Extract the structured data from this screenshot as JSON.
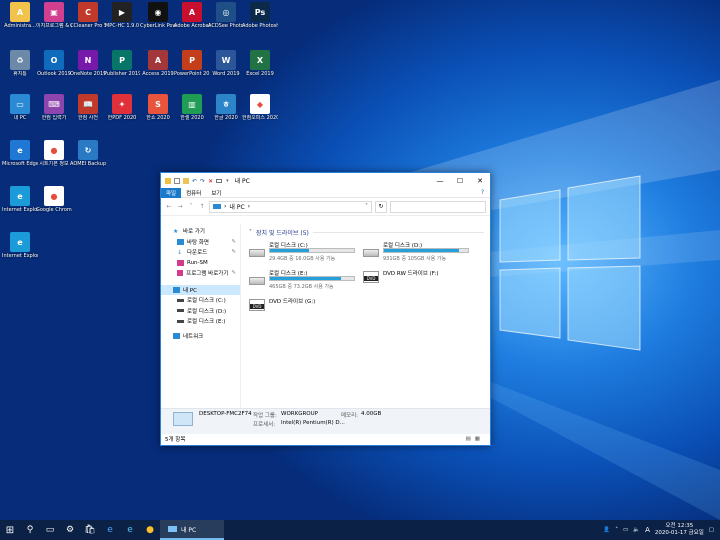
{
  "desktop": {
    "icons": [
      {
        "label": "Administra...",
        "icon": "user-folder-icon",
        "color": "#f3c24a",
        "glyph": "A"
      },
      {
        "label": "이지프로그램 & 종료기",
        "icon": "tv-icon",
        "color": "#d23f8e",
        "glyph": "▣"
      },
      {
        "label": "CCleaner Pro 5.63",
        "icon": "ccleaner-icon",
        "color": "#c0392b",
        "glyph": "C"
      },
      {
        "label": "MPC-HC 1.9.0",
        "icon": "mpc-icon",
        "color": "#222",
        "glyph": "▶"
      },
      {
        "label": "CyberLink PowerDV...",
        "icon": "powerdvd-icon",
        "color": "#111",
        "glyph": "◉"
      },
      {
        "label": "Adobe Acrobat DC",
        "icon": "acrobat-icon",
        "color": "#c8102e",
        "glyph": "A"
      },
      {
        "label": "ACDSee Photo Stud...",
        "icon": "acdsee-icon",
        "color": "#1e4f86",
        "glyph": "◎"
      },
      {
        "label": "Adobe Photosh...",
        "icon": "photoshop-icon",
        "color": "#0b2a4a",
        "glyph": "Ps"
      },
      {
        "label": "휴지통",
        "icon": "recycle-bin-icon",
        "color": "#6c8aa8",
        "glyph": "♻"
      },
      {
        "label": "Outlook 2019",
        "icon": "outlook-icon",
        "color": "#0f6cbd",
        "glyph": "O"
      },
      {
        "label": "OneNote 2019",
        "icon": "onenote-icon",
        "color": "#7719aa",
        "glyph": "N"
      },
      {
        "label": "Publisher 2019",
        "icon": "publisher-icon",
        "color": "#077568",
        "glyph": "P"
      },
      {
        "label": "Access 2019",
        "icon": "access-icon",
        "color": "#a4373a",
        "glyph": "A"
      },
      {
        "label": "PowerPoint 2019",
        "icon": "powerpoint-icon",
        "color": "#c43e1c",
        "glyph": "P"
      },
      {
        "label": "Word 2019",
        "icon": "word-icon",
        "color": "#2b579a",
        "glyph": "W"
      },
      {
        "label": "Excel 2019",
        "icon": "excel-icon",
        "color": "#217346",
        "glyph": "X"
      },
      {
        "label": "내 PC",
        "icon": "this-pc-icon",
        "color": "#2a8ad4",
        "glyph": "▭"
      },
      {
        "label": "한컴 입력기",
        "icon": "hancom-input-icon",
        "color": "#8e44ad",
        "glyph": "⌨"
      },
      {
        "label": "한컴 사전",
        "icon": "hancom-dictionary-icon",
        "color": "#c0392b",
        "glyph": "📖"
      },
      {
        "label": "한PDF 2020",
        "icon": "hanpdf-icon",
        "color": "#e0303a",
        "glyph": "✦"
      },
      {
        "label": "한쇼 2020",
        "icon": "hanshow-icon",
        "color": "#e8543c",
        "glyph": "S"
      },
      {
        "label": "한셀 2020",
        "icon": "hancell-icon",
        "color": "#1f9d55",
        "glyph": "▥"
      },
      {
        "label": "한글 2020",
        "icon": "hangul-icon",
        "color": "#2c85c8",
        "glyph": "ㅎ"
      },
      {
        "label": "한컴오피스 2020",
        "icon": "hancom-office-icon",
        "color": "#ffffff",
        "glyph": "◆"
      },
      {
        "label": "Microsoft Edge",
        "icon": "edge-icon",
        "color": "#1e78d4",
        "glyph": "e"
      },
      {
        "label": "시트기본 정보",
        "icon": "chrome-icon",
        "color": "#ffffff",
        "glyph": "●"
      },
      {
        "label": "AOMEI Backupp...",
        "icon": "aomei-icon",
        "color": "#2979c4",
        "glyph": "↻"
      },
      {
        "label": "Internet Explorer",
        "icon": "ie-icon",
        "color": "#1c9bd9",
        "glyph": "e"
      },
      {
        "label": "Google Chrome 79",
        "icon": "chrome-icon",
        "color": "#ffffff",
        "glyph": "●"
      },
      {
        "label": "Internet Explorer",
        "icon": "ie-icon",
        "color": "#1c9bd9",
        "glyph": "e"
      }
    ]
  },
  "window": {
    "title": "내 PC",
    "ribbon_tabs": [
      "파일",
      "컴퓨터",
      "보기"
    ],
    "breadcrumb": [
      "내 PC"
    ],
    "nav_items": [
      {
        "label": "바로 가기",
        "icon": "star-icon"
      },
      {
        "label": "바탕 화면",
        "icon": "desktop-icon"
      },
      {
        "label": "다운로드",
        "icon": "download-icon"
      },
      {
        "label": "Run-SM",
        "icon": "folder-icon"
      },
      {
        "label": "프로그램 바로가기",
        "icon": "folder-icon"
      },
      {
        "label": "내 PC",
        "icon": "this-pc-icon"
      },
      {
        "label": "로컬 디스크 (C:)",
        "icon": "drive-icon"
      },
      {
        "label": "로컬 디스크 (D:)",
        "icon": "drive-icon"
      },
      {
        "label": "로컬 디스크 (E:)",
        "icon": "drive-icon"
      },
      {
        "label": "네트워크",
        "icon": "network-icon"
      }
    ],
    "group_title": "장치 및 드라이브 (5)",
    "drives": [
      {
        "name": "로컬 디스크 (C:)",
        "free": "29.4GB 중 16.0GB 사용 가능",
        "used_fraction": 0.46,
        "kind": "hdd"
      },
      {
        "name": "로컬 디스크 (D:)",
        "free": "931GB 중 105GB 사용 가능",
        "used_fraction": 0.89,
        "kind": "hdd"
      },
      {
        "name": "로컬 디스크 (E:)",
        "free": "465GB 중 73.2GB 사용 가능",
        "used_fraction": 0.84,
        "kind": "hdd"
      },
      {
        "name": "DVD RW 드라이브 (F:)",
        "free": "",
        "used_fraction": null,
        "kind": "dvd"
      },
      {
        "name": "DVD 드라이브 (G:)",
        "free": "",
        "used_fraction": null,
        "kind": "dvd"
      }
    ],
    "details": {
      "computer_name": "DESKTOP-FMC2F74",
      "workgroup_label": "작업 그룹:",
      "workgroup": "WORKGROUP",
      "memory_label": "메모리:",
      "memory": "4.00GB",
      "processor_label": "프로세서:",
      "processor": "Intel(R) Pentium(R) D..."
    },
    "status": "5개 항목"
  },
  "taskbar": {
    "active_app": "내 PC",
    "ime": "A",
    "time": "오전 12:35",
    "date": "2020-01-17 금요일"
  }
}
